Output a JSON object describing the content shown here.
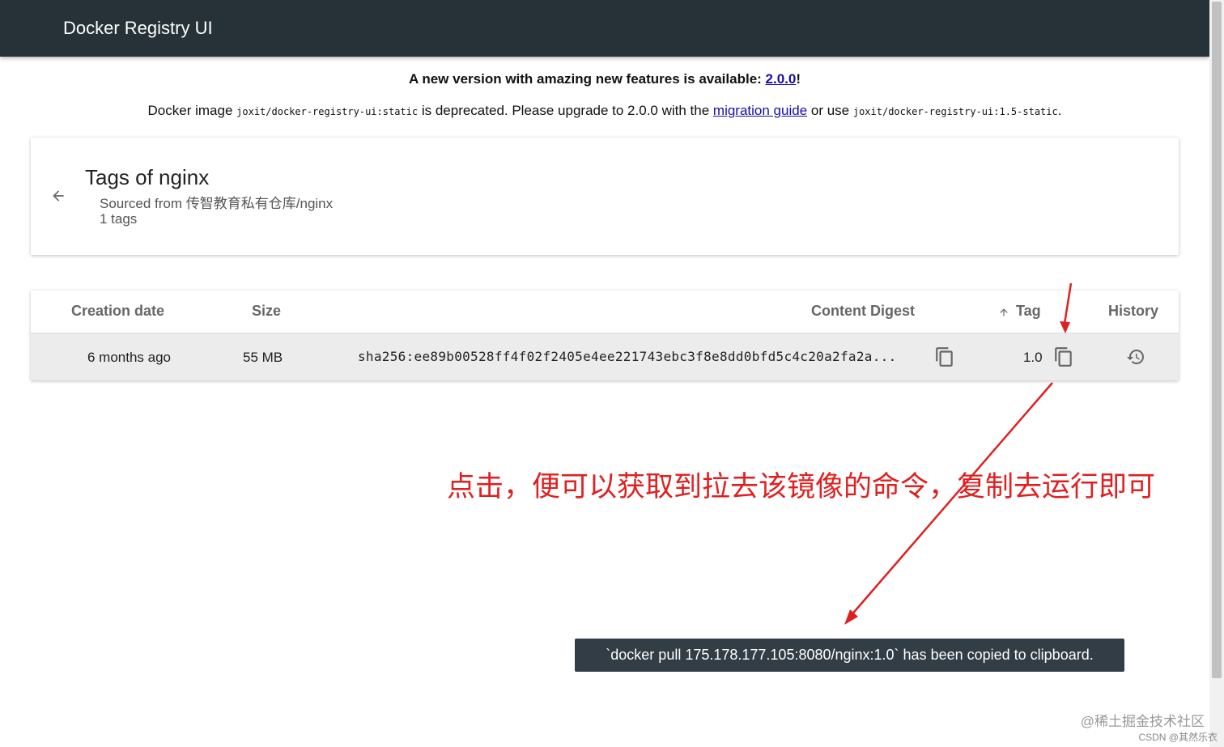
{
  "header": {
    "title": "Docker Registry UI"
  },
  "notice": {
    "line1_prefix": "A new version with amazing new features is available: ",
    "line1_link": "2.0.0",
    "line1_suffix": "!",
    "line2_part1": "Docker image ",
    "line2_image": "joxit/docker-registry-ui:static",
    "line2_part2": " is deprecated. Please upgrade to 2.0.0 with the ",
    "line2_link": "migration guide",
    "line2_part3": " or use ",
    "line2_image2": "joxit/docker-registry-ui:1.5-static",
    "line2_part4": "."
  },
  "repo_card": {
    "title": "Tags of nginx",
    "sourced_from": "Sourced from 传智教育私有仓库/nginx",
    "tag_count": "1 tags",
    "back_icon": "arrow-left-icon"
  },
  "table": {
    "headers": {
      "creation_date": "Creation date",
      "size": "Size",
      "content_digest": "Content Digest",
      "tag": "Tag",
      "history": "History"
    },
    "rows": [
      {
        "creation_date": "6 months ago",
        "size": "55 MB",
        "content_digest": "sha256:ee89b00528ff4f02f2405e4ee221743ebc3f8e8dd0bfd5c4c20a2fa2a...",
        "tag": "1.0"
      }
    ]
  },
  "annotation": {
    "text": "点击，便可以获取到拉去该镜像的命令，复制去运行即可",
    "color": "#e02020"
  },
  "toast": {
    "message": "`docker pull 175.178.177.105:8080/nginx:1.0` has been copied to clipboard."
  },
  "watermark": {
    "line1": "@稀土掘金技术社区",
    "line2": "CSDN @其然乐衣"
  },
  "colors": {
    "header_bg": "#263238",
    "row_bg": "#ececec",
    "toast_bg": "#323d45",
    "link": "#1a0dab"
  }
}
